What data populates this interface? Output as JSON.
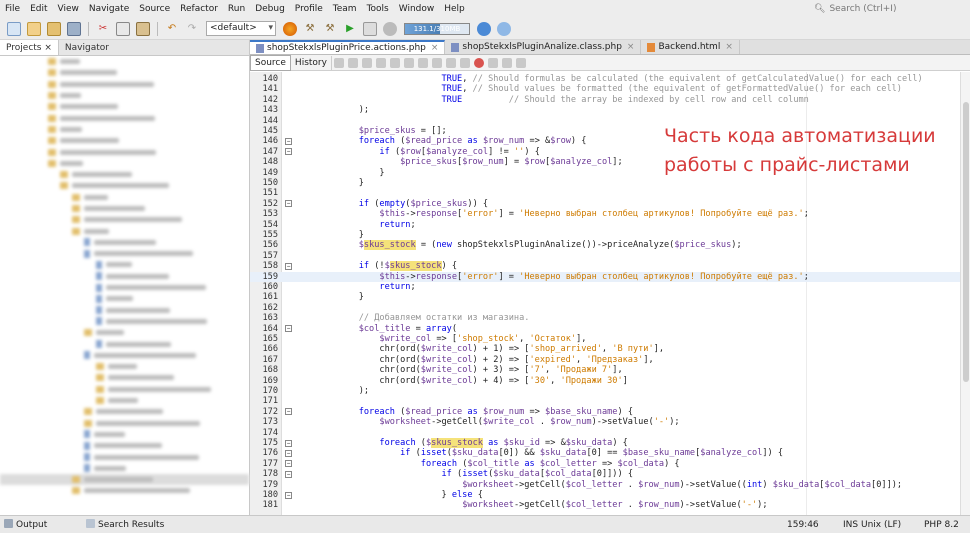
{
  "menu": [
    "File",
    "Edit",
    "View",
    "Navigate",
    "Source",
    "Refactor",
    "Run",
    "Debug",
    "Profile",
    "Team",
    "Tools",
    "Window",
    "Help"
  ],
  "search": {
    "placeholder": "Search (Ctrl+I)"
  },
  "toolbar": {
    "config": "<default>",
    "memory": "131.1/310MB"
  },
  "left_tabs": [
    {
      "label": "Projects",
      "close": "×"
    },
    {
      "label": "Navigator"
    }
  ],
  "file_tabs": [
    {
      "label": "shopStekxlsPluginPrice.actions.php",
      "active": true
    },
    {
      "label": "shopStekxlsPluginAnalize.class.php",
      "active": false
    },
    {
      "label": "Backend.html",
      "active": false
    }
  ],
  "view_buttons": [
    "Source",
    "History"
  ],
  "overlay_text": [
    "Часть кода автоматизации",
    "работы с прайс-листами"
  ],
  "code_lines": [
    {
      "n": "140",
      "html": "                    <span class=\"kw\">TRUE</span>, <span class=\"cm\">// Should formulas be calculated (the equivalent of getCalculatedValue() for each cell)</span>"
    },
    {
      "n": "141",
      "html": "                    <span class=\"kw\">TRUE</span>, <span class=\"cm\">// Should values be formatted (the equivalent of getFormattedValue() for each cell)</span>"
    },
    {
      "n": "142",
      "html": "                    <span class=\"kw\">TRUE</span>         <span class=\"cm\">// Should the array be indexed by cell row and cell column</span>"
    },
    {
      "n": "143",
      "html": "    );"
    },
    {
      "n": "144",
      "html": ""
    },
    {
      "n": "145",
      "html": "    <span class=\"var\">$price_skus</span> = [];"
    },
    {
      "n": "146",
      "fold": true,
      "html": "    <span class=\"kw\">foreach</span> (<span class=\"var\">$read_price</span> <span class=\"kw\">as</span> <span class=\"var\">$row_num</span> => &amp;<span class=\"var\">$row</span>) {"
    },
    {
      "n": "147",
      "fold": true,
      "html": "        <span class=\"kw\">if</span> (<span class=\"var\">$row</span>[<span class=\"var\">$analyze_col</span>] != <span class=\"str\">''</span>) {"
    },
    {
      "n": "148",
      "html": "            <span class=\"var\">$price_skus</span>[<span class=\"var\">$row_num</span>] = <span class=\"var\">$row</span>[<span class=\"var\">$analyze_col</span>];"
    },
    {
      "n": "149",
      "html": "        }"
    },
    {
      "n": "150",
      "html": "    }"
    },
    {
      "n": "151",
      "html": ""
    },
    {
      "n": "152",
      "fold": true,
      "html": "    <span class=\"kw\">if</span> (<span class=\"kw\">empty</span>(<span class=\"var\">$price_skus</span>)) {"
    },
    {
      "n": "153",
      "html": "        <span class=\"var\">$this</span>-><span class=\"var\">response</span>[<span class=\"str\">'error'</span>] = <span class=\"str\">'Неверно выбран столбец артикулов! Попробуйте ещё раз.'</span>;"
    },
    {
      "n": "154",
      "html": "        <span class=\"kw\">return</span>;"
    },
    {
      "n": "155",
      "html": "    }"
    },
    {
      "n": "156",
      "html": "    <span class=\"var\">$<span class=\"hl\">skus_stock</span></span> = (<span class=\"kw\">new</span> shopStekxlsPluginAnalize())->priceAnalyze(<span class=\"var\">$price_skus</span>);"
    },
    {
      "n": "157",
      "html": ""
    },
    {
      "n": "158",
      "fold": true,
      "html": "    <span class=\"kw\">if</span> (!<span class=\"var\">$<span class=\"hl\">skus_stock</span></span>) {"
    },
    {
      "n": "159",
      "cur": true,
      "html": "        <span class=\"var\">$this</span>-><span class=\"var\">response</span>[<span class=\"str\">'error'</span>] = <span class=\"str\">'Неверно выбран столбец артикулов! Попробуйте ещё раз.'</span>;"
    },
    {
      "n": "160",
      "html": "        <span class=\"kw\">return</span>;"
    },
    {
      "n": "161",
      "html": "    }"
    },
    {
      "n": "162",
      "html": ""
    },
    {
      "n": "163",
      "html": "    <span class=\"cm\">// Добавляем остатки из магазина.</span>"
    },
    {
      "n": "164",
      "fold": true,
      "html": "    <span class=\"var\">$col_title</span> = <span class=\"kw\">array</span>("
    },
    {
      "n": "165",
      "html": "        <span class=\"var\">$write_col</span> => [<span class=\"str\">'shop_stock'</span>, <span class=\"str\">'Остаток'</span>],"
    },
    {
      "n": "166",
      "html": "        chr(ord(<span class=\"var\">$write_col</span>) + 1) => [<span class=\"str\">'shop_arrived'</span>, <span class=\"str\">'В пути'</span>],"
    },
    {
      "n": "167",
      "html": "        chr(ord(<span class=\"var\">$write_col</span>) + 2) => [<span class=\"str\">'expired'</span>, <span class=\"str\">'Предзаказ'</span>],"
    },
    {
      "n": "168",
      "html": "        chr(ord(<span class=\"var\">$write_col</span>) + 3) => [<span class=\"str\">'7'</span>, <span class=\"str\">'Продажи 7'</span>],"
    },
    {
      "n": "169",
      "html": "        chr(ord(<span class=\"var\">$write_col</span>) + 4) => [<span class=\"str\">'30'</span>, <span class=\"str\">'Продажи 30'</span>]"
    },
    {
      "n": "170",
      "html": "    );"
    },
    {
      "n": "171",
      "html": ""
    },
    {
      "n": "172",
      "fold": true,
      "html": "    <span class=\"kw\">foreach</span> (<span class=\"var\">$read_price</span> <span class=\"kw\">as</span> <span class=\"var\">$row_num</span> => <span class=\"var\">$base_sku_name</span>) {"
    },
    {
      "n": "173",
      "html": "        <span class=\"var\">$worksheet</span>->getCell(<span class=\"var\">$write_col</span> . <span class=\"var\">$row_num</span>)->setValue(<span class=\"str\">'-'</span>);"
    },
    {
      "n": "174",
      "html": ""
    },
    {
      "n": "175",
      "fold": true,
      "html": "        <span class=\"kw\">foreach</span> (<span class=\"var\">$<span class=\"hl\">skus_stock</span></span> <span class=\"kw\">as</span> <span class=\"var\">$sku_id</span> => &amp;<span class=\"var\">$sku_data</span>) {"
    },
    {
      "n": "176",
      "fold": true,
      "html": "            <span class=\"kw\">if</span> (<span class=\"kw\">isset</span>(<span class=\"var\">$sku_data</span>[0]) &amp;&amp; <span class=\"var\">$sku_data</span>[0] == <span class=\"var\">$base_sku_name</span>[<span class=\"var\">$analyze_col</span>]) {"
    },
    {
      "n": "177",
      "fold": true,
      "html": "                <span class=\"kw\">foreach</span> (<span class=\"var\">$col_title</span> <span class=\"kw\">as</span> <span class=\"var\">$col_letter</span> => <span class=\"var\">$col_data</span>) {"
    },
    {
      "n": "178",
      "fold": true,
      "html": "                    <span class=\"kw\">if</span> (<span class=\"kw\">isset</span>(<span class=\"var\">$sku_data</span>[<span class=\"var\">$col_data</span>[0]])) {"
    },
    {
      "n": "179",
      "html": "                        <span class=\"var\">$worksheet</span>->getCell(<span class=\"var\">$col_letter</span> . <span class=\"var\">$row_num</span>)->setValue((<span class=\"kw\">int</span>) <span class=\"var\">$sku_data</span>[<span class=\"var\">$col_data</span>[0]]);"
    },
    {
      "n": "180",
      "fold": true,
      "html": "                    } <span class=\"kw\">else</span> {"
    },
    {
      "n": "181",
      "html": "                        <span class=\"var\">$worksheet</span>->getCell(<span class=\"var\">$col_letter</span> . <span class=\"var\">$row_num</span>)->setValue(<span class=\"str\">'-'</span>);"
    }
  ],
  "status": {
    "output": "Output",
    "search_results": "Search Results",
    "position": "159:46",
    "mode": "INS",
    "line_ending": "Unix (LF)",
    "language": "PHP 8.2"
  },
  "colors": {
    "overlay_text": "#d63a3a",
    "keyword": "#0000e6",
    "string": "#ce7b00",
    "variable": "#6c3a96",
    "comment": "#969696",
    "highlight": "#f5e27a"
  }
}
